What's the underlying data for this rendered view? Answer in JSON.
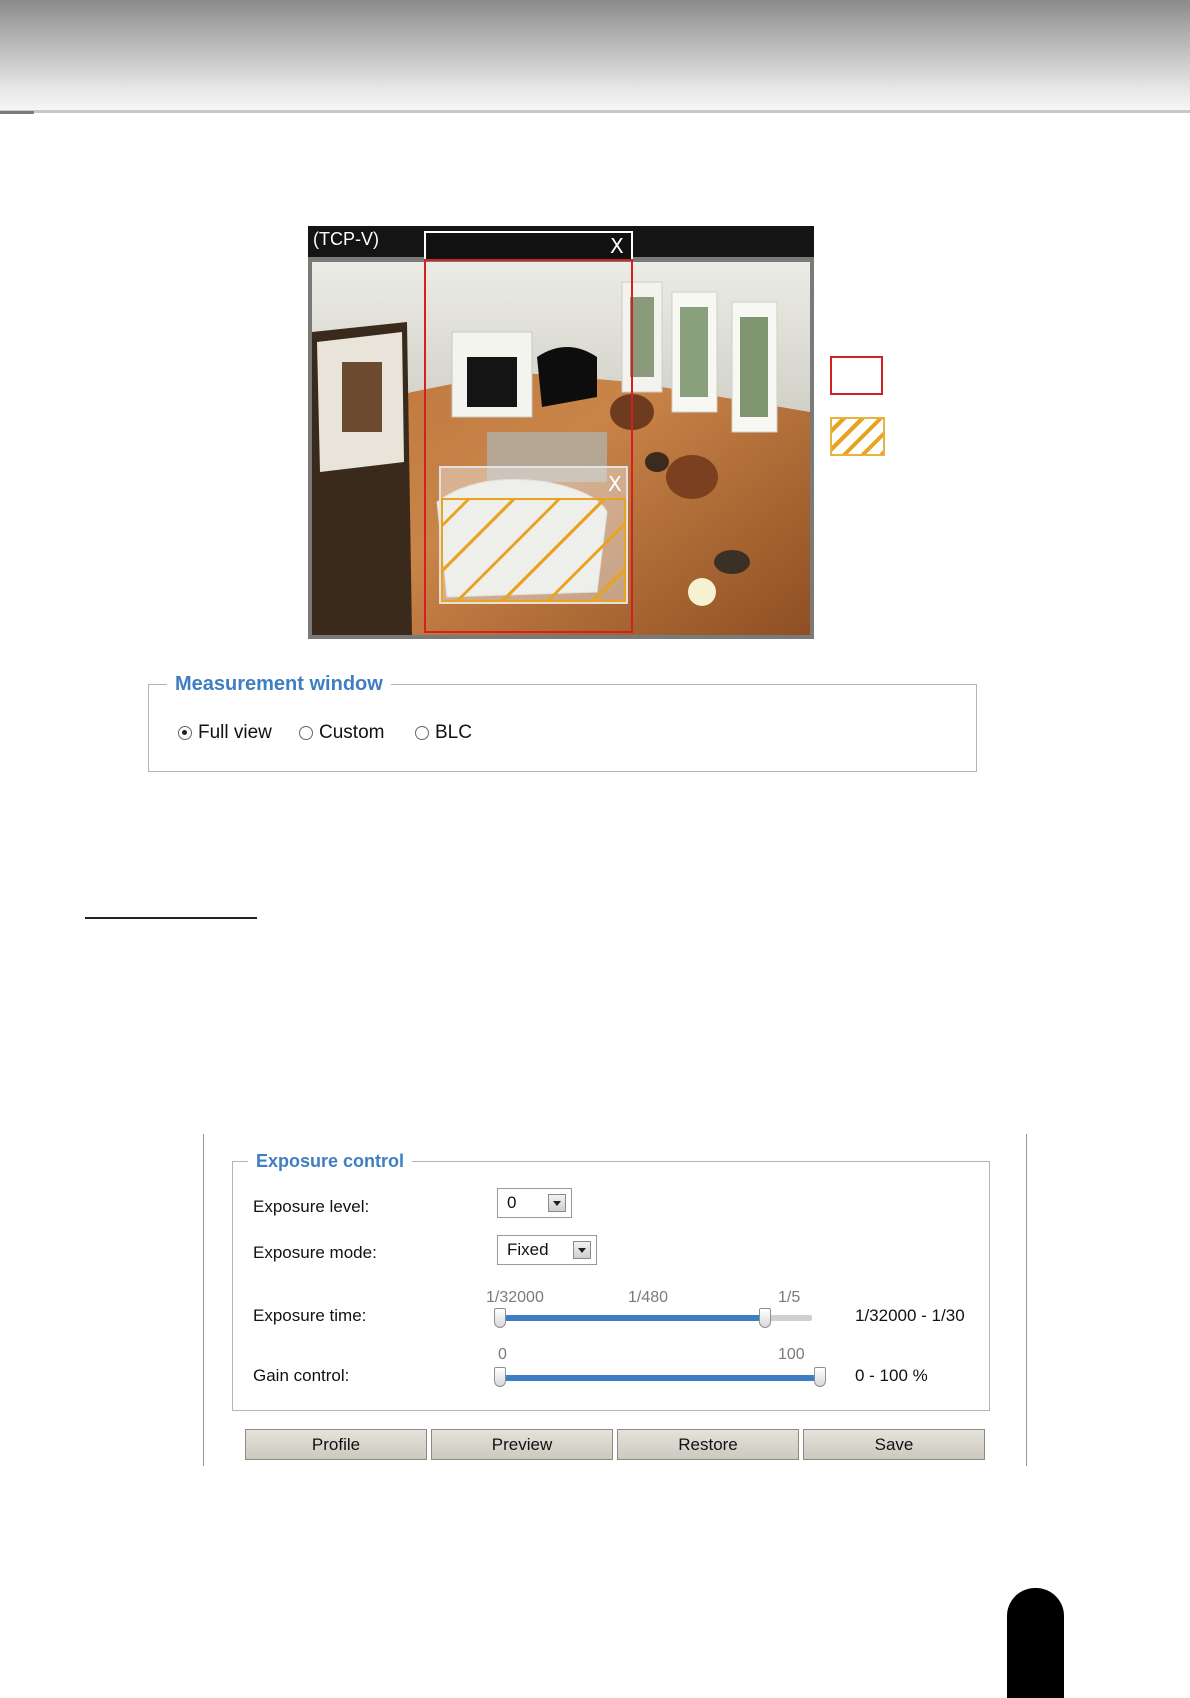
{
  "viewer": {
    "label": "(TCP-V)",
    "roi_close": "X",
    "blc_close": "X"
  },
  "colors": {
    "roi": "#d42020",
    "blc": "#e8a321",
    "title_blue": "#3f7ec0",
    "slider_fill": "#3d7ec4"
  },
  "measurement": {
    "title": "Measurement window",
    "options": [
      {
        "label": "Full view",
        "selected": true
      },
      {
        "label": "Custom",
        "selected": false
      },
      {
        "label": "BLC",
        "selected": false
      }
    ]
  },
  "exposure": {
    "title": "Exposure control",
    "level": {
      "label": "Exposure level:",
      "value": "0"
    },
    "mode": {
      "label": "Exposure mode:",
      "value": "Fixed"
    },
    "time": {
      "label": "Exposure time:",
      "ticks": [
        "1/32000",
        "1/480",
        "1/5"
      ],
      "fill_fraction": 0.85,
      "range": "1/32000 - 1/30"
    },
    "gain": {
      "label": "Gain control:",
      "ticks": [
        "0",
        "100"
      ],
      "fill_fraction": 1.0,
      "range": "0 - 100 %"
    }
  },
  "buttons": {
    "profile": "Profile",
    "preview": "Preview",
    "restore": "Restore",
    "save": "Save"
  }
}
